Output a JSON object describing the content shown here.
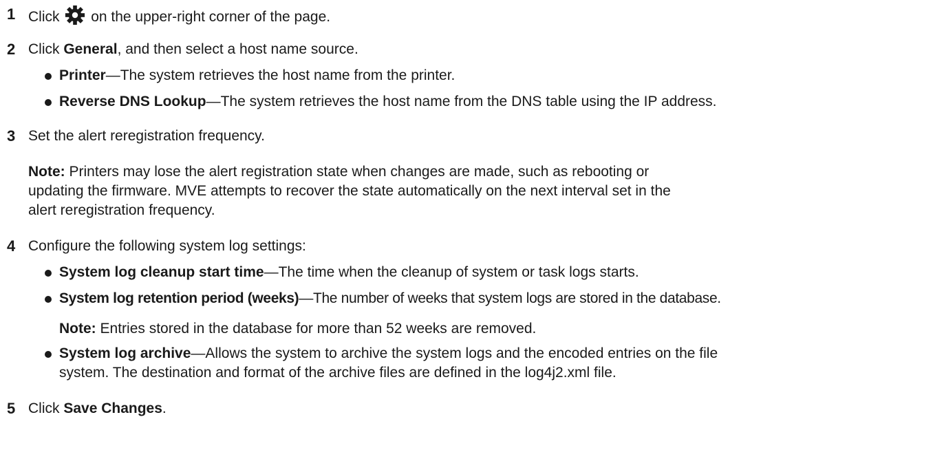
{
  "steps": [
    {
      "number": "1",
      "pre": "Click",
      "icon": "gear-icon",
      "post": "on the upper-right corner of the page."
    },
    {
      "number": "2",
      "pre": "Click",
      "bold": "General",
      "post": ", and then select a host name source.",
      "bullets": [
        {
          "term": "Printer",
          "desc": "—The system retrieves the host name from the printer."
        },
        {
          "term": "Reverse DNS Lookup",
          "desc": "—The system retrieves the host name from the DNS table using the IP address."
        }
      ]
    },
    {
      "number": "3",
      "text": "Set the alert reregistration frequency.",
      "note_label": "Note:",
      "note_line1": "Printers may lose the alert registration state when changes are made, such as rebooting or",
      "note_line2": "updating the firmware. MVE attempts to recover the state automatically on the next interval set in the",
      "note_line3": "alert reregistration frequency."
    },
    {
      "number": "4",
      "text": "Configure the following system log settings:",
      "bullets": [
        {
          "term": "System log cleanup start time",
          "desc": "—The time when the cleanup of system or task logs starts."
        },
        {
          "term": "System log retention period (weeks)",
          "desc": "—The number of weeks that system logs are stored in the database."
        },
        {
          "term": "System log archive",
          "desc": "—Allows the system to archive the system logs and the encoded entries on the file",
          "desc2": "system. The destination and format of the archive files are defined in the log4j2.xml file."
        }
      ],
      "note_label": "Note:",
      "note_text": "Entries stored in the database for more than 52 weeks are removed."
    },
    {
      "number": "5",
      "pre": "Click",
      "bold": "Save Changes",
      "post": "."
    }
  ]
}
